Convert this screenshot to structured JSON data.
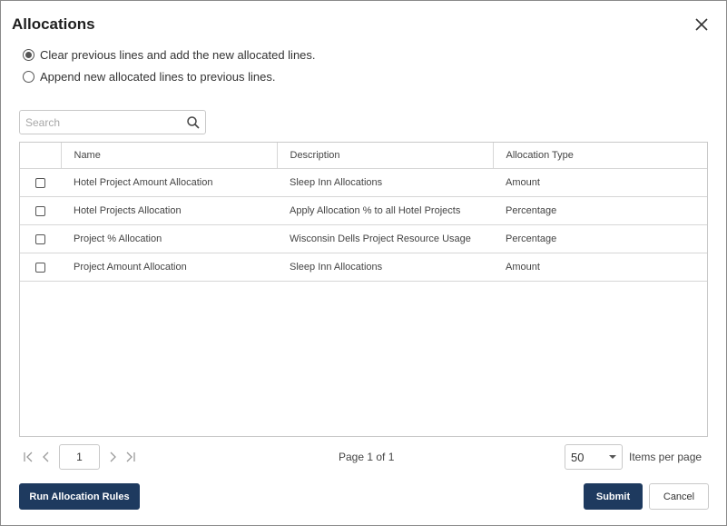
{
  "dialog": {
    "title": "Allocations"
  },
  "options": [
    {
      "label": "Clear previous lines and add the new allocated lines.",
      "selected": true
    },
    {
      "label": "Append new allocated lines to previous lines.",
      "selected": false
    }
  ],
  "search": {
    "placeholder": "Search",
    "value": ""
  },
  "table": {
    "columns": [
      "Name",
      "Description",
      "Allocation Type"
    ],
    "rows": [
      {
        "name": "Hotel Project Amount Allocation",
        "description": "Sleep Inn Allocations",
        "type": "Amount",
        "checked": false
      },
      {
        "name": "Hotel Projects Allocation",
        "description": "Apply Allocation % to all Hotel Projects",
        "type": "Percentage",
        "checked": false
      },
      {
        "name": "Project % Allocation",
        "description": "Wisconsin Dells Project Resource Usage",
        "type": "Percentage",
        "checked": false
      },
      {
        "name": "Project Amount Allocation",
        "description": "Sleep Inn Allocations",
        "type": "Amount",
        "checked": false
      }
    ]
  },
  "pager": {
    "current_page": "1",
    "page_info": "Page 1 of 1",
    "page_size": "50",
    "items_per_page_label": "Items per page"
  },
  "buttons": {
    "run": "Run Allocation Rules",
    "submit": "Submit",
    "cancel": "Cancel"
  },
  "colors": {
    "primary": "#1e3a5f",
    "border": "#c8c8c8"
  }
}
